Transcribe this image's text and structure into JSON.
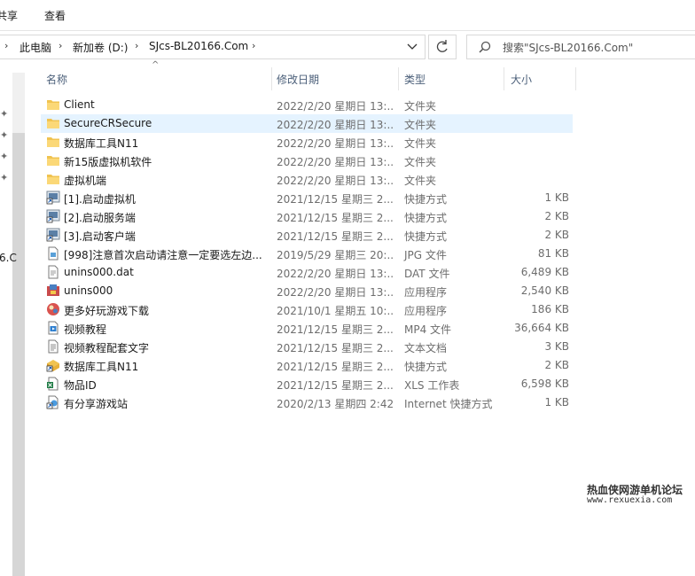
{
  "ribbon": {
    "share": "共享",
    "view": "查看"
  },
  "breadcrumb": [
    "此电脑",
    "新加卷 (D:)",
    "SJcs-BL20166.Com"
  ],
  "search": {
    "placeholder": "搜索\"SJcs-BL20166.Com\""
  },
  "nav": {
    "fragment": "6.C"
  },
  "columns": {
    "name": "名称",
    "date": "修改日期",
    "type": "类型",
    "size": "大小"
  },
  "files": [
    {
      "name": "Client",
      "date": "2022/2/20 星期日 13:...",
      "type": "文件夹",
      "size": "",
      "icon": "folder-icon"
    },
    {
      "name": "SecureCRSecure",
      "date": "2022/2/20 星期日 13:...",
      "type": "文件夹",
      "size": "",
      "icon": "folder-icon"
    },
    {
      "name": "数据库工具N11",
      "date": "2022/2/20 星期日 13:...",
      "type": "文件夹",
      "size": "",
      "icon": "folder-icon"
    },
    {
      "name": "新15版虚拟机软件",
      "date": "2022/2/20 星期日 13:...",
      "type": "文件夹",
      "size": "",
      "icon": "folder-icon"
    },
    {
      "name": "虚拟机端",
      "date": "2022/2/20 星期日 13:...",
      "type": "文件夹",
      "size": "",
      "icon": "folder-icon"
    },
    {
      "name": "[1].启动虚拟机",
      "date": "2021/12/15 星期三 2...",
      "type": "快捷方式",
      "size": "1 KB",
      "icon": "shortcut-icon"
    },
    {
      "name": "[2].启动服务端",
      "date": "2021/12/15 星期三 2...",
      "type": "快捷方式",
      "size": "2 KB",
      "icon": "shortcut-icon"
    },
    {
      "name": "[3].启动客户端",
      "date": "2021/12/15 星期三 2...",
      "type": "快捷方式",
      "size": "2 KB",
      "icon": "shortcut-icon"
    },
    {
      "name": "[998]注意首次启动请注意一定要选左边...",
      "date": "2019/5/29 星期三 20:...",
      "type": "JPG 文件",
      "size": "81 KB",
      "icon": "image-file-icon"
    },
    {
      "name": "unins000.dat",
      "date": "2022/2/20 星期日 13:...",
      "type": "DAT 文件",
      "size": "6,489 KB",
      "icon": "data-file-icon"
    },
    {
      "name": "unins000",
      "date": "2022/2/20 星期日 13:...",
      "type": "应用程序",
      "size": "2,540 KB",
      "icon": "uninstall-app-icon"
    },
    {
      "name": "更多好玩游戏下载",
      "date": "2021/10/1 星期五 10:...",
      "type": "应用程序",
      "size": "186 KB",
      "icon": "game-app-icon"
    },
    {
      "name": "视频教程",
      "date": "2021/12/15 星期三 2...",
      "type": "MP4 文件",
      "size": "36,664 KB",
      "icon": "video-file-icon"
    },
    {
      "name": "视频教程配套文字",
      "date": "2021/12/15 星期三 2...",
      "type": "文本文档",
      "size": "3 KB",
      "icon": "text-file-icon"
    },
    {
      "name": "数据库工具N11",
      "date": "2021/12/15 星期三 2...",
      "type": "快捷方式",
      "size": "2 KB",
      "icon": "db-shortcut-icon"
    },
    {
      "name": "物品ID",
      "date": "2021/12/15 星期三 2...",
      "type": "XLS 工作表",
      "size": "6,598 KB",
      "icon": "excel-file-icon"
    },
    {
      "name": "有分享游戏站",
      "date": "2020/2/13 星期四 2:42",
      "type": "Internet 快捷方式",
      "size": "1 KB",
      "icon": "internet-shortcut-icon"
    }
  ],
  "selected_index": 1,
  "watermark": {
    "line1": "热血侠网游单机论坛",
    "line2": "www.rexuexia.com"
  }
}
